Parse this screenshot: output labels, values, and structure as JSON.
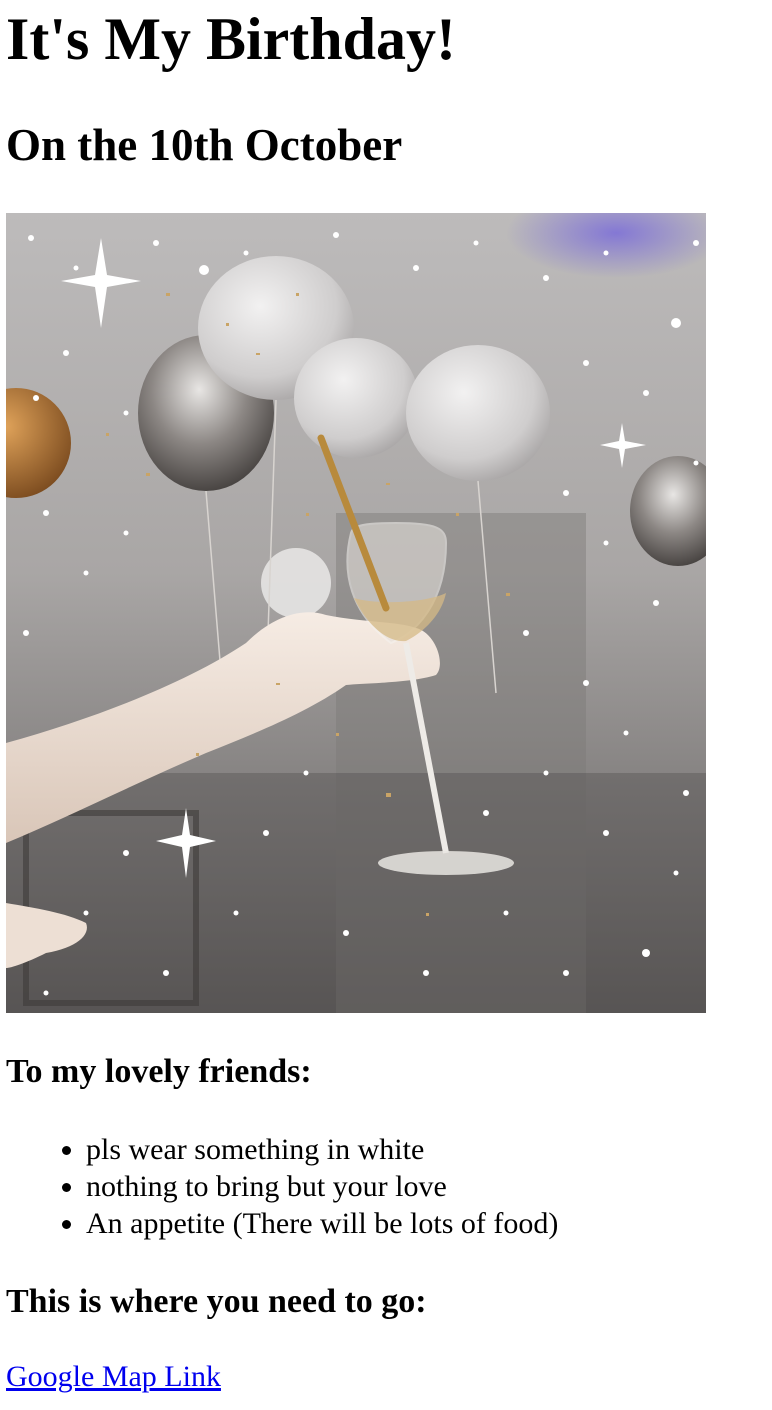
{
  "page": {
    "title": "It's My Birthday!",
    "subtitle": "On the 10th October"
  },
  "photo": {
    "alt": "Hand holding a champagne glass with a sparkler among white balloons and confetti"
  },
  "friends": {
    "heading": "To my lovely friends:",
    "items": [
      "pls wear something in white",
      "nothing to bring but your love",
      "An appetite (There will be lots of food)"
    ]
  },
  "directions": {
    "heading": "This is where you need to go:",
    "link_label": "Google Map Link"
  },
  "colors": {
    "link": "#0000ee",
    "text": "#000000",
    "background": "#ffffff"
  }
}
